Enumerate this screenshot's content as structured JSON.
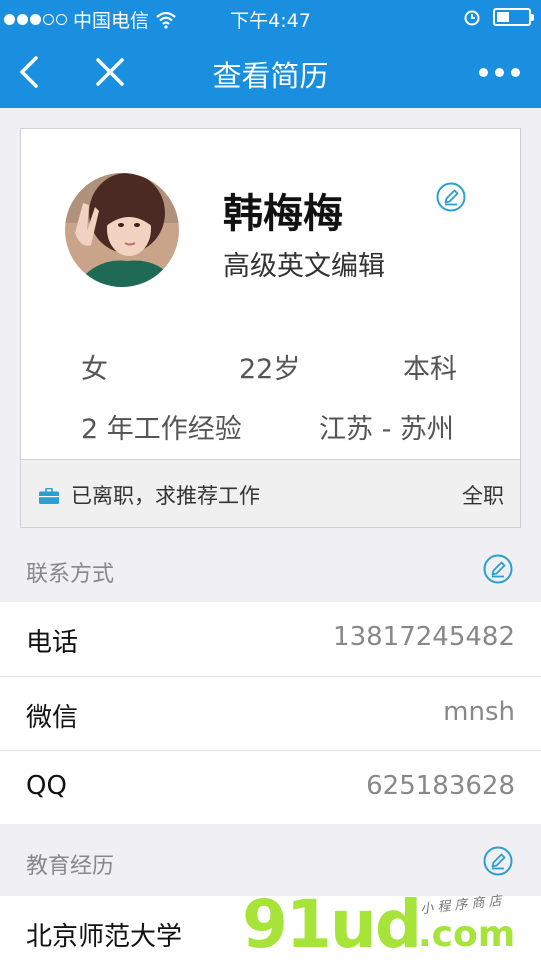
{
  "status_bar": {
    "carrier": "中国电信",
    "time": "下午4:47"
  },
  "nav": {
    "title": "查看简历"
  },
  "profile": {
    "name": "韩梅梅",
    "position": "高级英文编辑",
    "gender": "女",
    "age": "22岁",
    "education": "本科",
    "experience": "2 年工作经验",
    "location": "江苏 - 苏州",
    "job_status": "已离职，求推荐工作",
    "job_type": "全职"
  },
  "contact": {
    "header": "联系方式",
    "rows": [
      {
        "label": "电话",
        "value": "13817245482"
      },
      {
        "label": "微信",
        "value": "mnsh"
      },
      {
        "label": "QQ",
        "value": "625183628"
      }
    ]
  },
  "education": {
    "header": "教育经历",
    "school": "北京师范大学"
  },
  "watermark": {
    "main": "91ud",
    "small": "小 程 序 商 店",
    "suffix": ".com"
  },
  "colors": {
    "primary": "#1a8fe0",
    "edit_icon": "#2a9fd0",
    "watermark": "#a6e43a"
  }
}
